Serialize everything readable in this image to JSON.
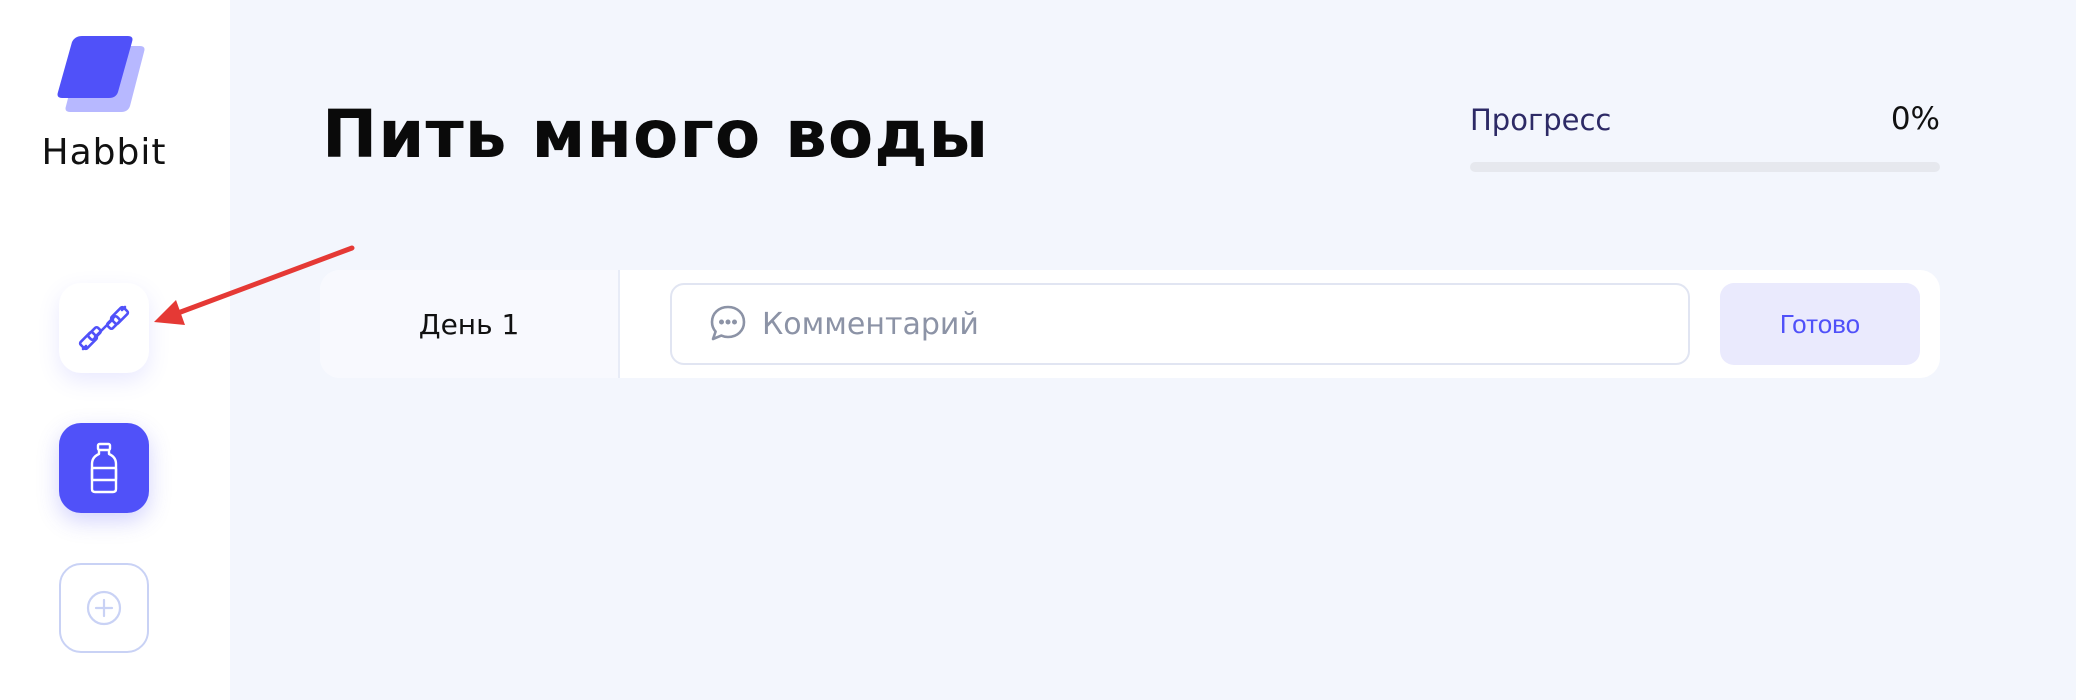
{
  "app": {
    "name": "Habbit"
  },
  "sidebar": {
    "habits": [
      {
        "icon": "dumbbell-icon",
        "state": "inactive"
      },
      {
        "icon": "bottle-icon",
        "state": "active"
      }
    ],
    "add_icon": "plus-circle-icon"
  },
  "habit": {
    "title": "Пить много воды",
    "progress_label": "Прогресс",
    "progress_value": "0%",
    "progress_fraction": 0
  },
  "days": [
    {
      "label": "День 1",
      "comment_value": "",
      "comment_placeholder": "Комментарий",
      "comment_icon": "chat-bubble-icon",
      "done_label": "Готово"
    }
  ],
  "colors": {
    "accent": "#5051F9",
    "background": "#F3F6FD",
    "annotation": "#E53935"
  }
}
